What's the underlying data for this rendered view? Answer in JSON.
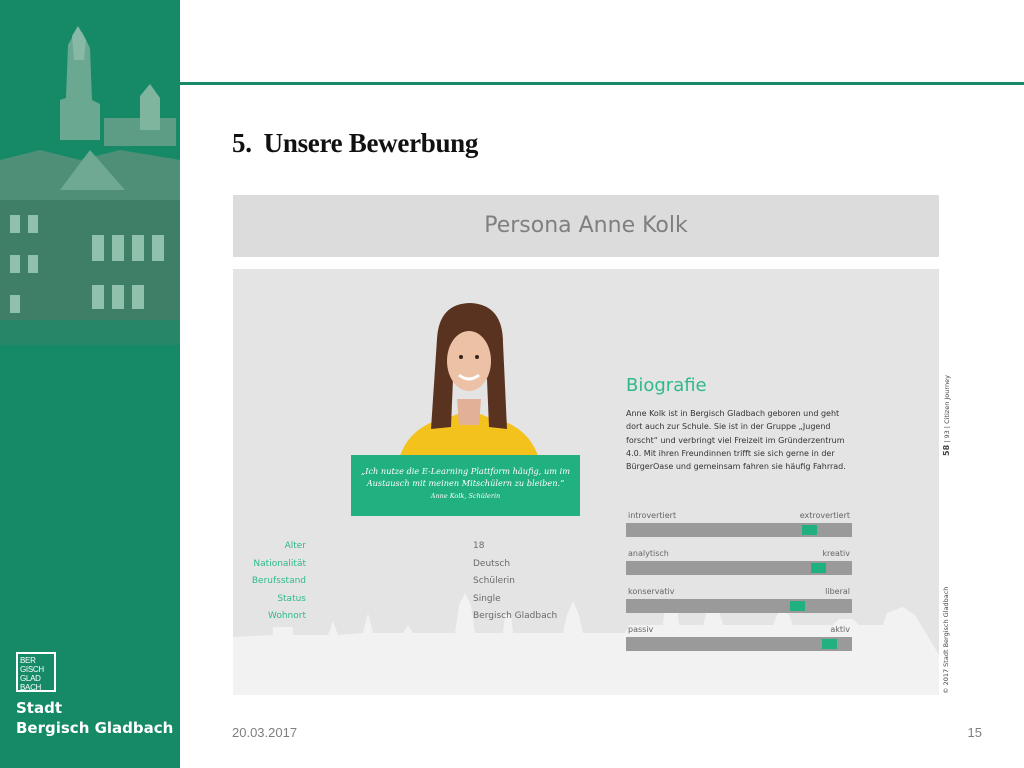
{
  "sidebar": {
    "logo_lines": [
      "BER",
      "GISCH",
      "GLAD",
      "BACH"
    ],
    "city_line1": "Stadt",
    "city_line2": "Bergisch Gladbach"
  },
  "slide": {
    "number": "5.",
    "title": "Unsere Bewerbung"
  },
  "persona": {
    "title": "Persona Anne Kolk",
    "quote": "„Ich nutze die E-Learning Plattform häufig, um im Austausch mit meinen Mitschülern zu bleiben.“",
    "quote_author": "Anne Kolk, Schülerin",
    "facts": [
      {
        "label": "Alter",
        "value": "18"
      },
      {
        "label": "Nationalität",
        "value": "Deutsch"
      },
      {
        "label": "Berufsstand",
        "value": "Schülerin"
      },
      {
        "label": "Status",
        "value": "Single"
      },
      {
        "label": "Wohnort",
        "value": "Bergisch Gladbach"
      }
    ],
    "bio_title": "Biografie",
    "bio_text": "Anne Kolk ist in Bergisch Gladbach geboren und geht dort auch zur Schule. Sie ist in der Gruppe „Jugend forscht“ und verbringt viel Freizeit im Gründerzentrum 4.0. Mit ihren Freundinnen trifft sie sich gerne in der BürgerOase und gemeinsam fahren sie häufig Fahrrad.",
    "scales": [
      {
        "left": "introvertiert",
        "right": "extrovertiert",
        "value": 0.81
      },
      {
        "left": "analytisch",
        "right": "kreativ",
        "value": 0.85
      },
      {
        "left": "konservativ",
        "right": "liberal",
        "value": 0.76
      },
      {
        "left": "passiv",
        "right": "aktiv",
        "value": 0.9
      }
    ],
    "side_caption_page": "58",
    "side_caption_sep": "| 93 |",
    "side_caption_title": "Citizen Journey",
    "side_caption_copyright": "© 2017 Stadt Bergisch Gladbach"
  },
  "footer": {
    "date": "20.03.2017",
    "page": "15"
  },
  "colors": {
    "brand_green": "#168a67",
    "accent_green": "#21b07f"
  }
}
